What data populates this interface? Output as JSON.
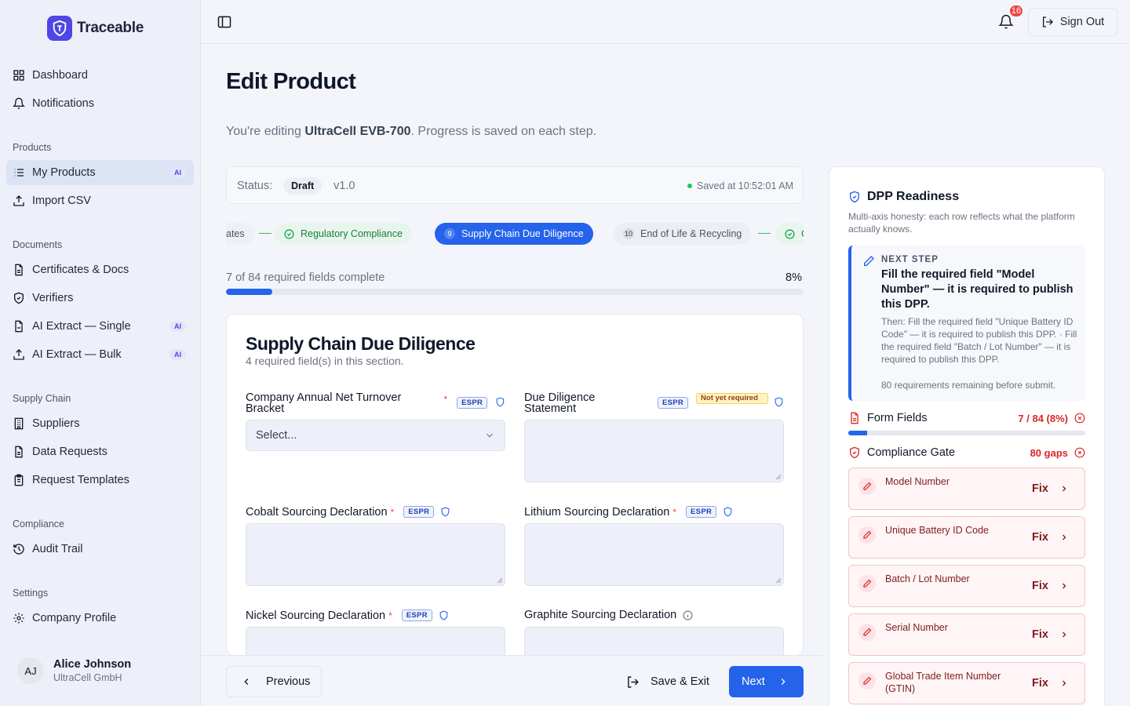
{
  "app": {
    "name": "Traceable"
  },
  "sidebar": {
    "top": [
      {
        "label": "Dashboard"
      },
      {
        "label": "Notifications"
      }
    ],
    "sections": {
      "products": "Products",
      "documents": "Documents",
      "supply_chain": "Supply Chain",
      "compliance": "Compliance",
      "settings": "Settings"
    },
    "items": {
      "my_products": "My Products",
      "import_csv": "Import CSV",
      "certificates": "Certificates & Docs",
      "verifiers": "Verifiers",
      "ai_single": "AI Extract — Single",
      "ai_bulk": "AI Extract — Bulk",
      "suppliers": "Suppliers",
      "data_requests": "Data Requests",
      "request_templates": "Request Templates",
      "audit_trail": "Audit Trail",
      "company_profile": "Company Profile"
    },
    "ai_badge": "AI",
    "user": {
      "initials": "AJ",
      "name": "Alice Johnson",
      "org": "UltraCell GmbH"
    }
  },
  "topbar": {
    "notification_count": "16",
    "sign_out": "Sign Out"
  },
  "page": {
    "title": "Edit Product",
    "subtitle_prefix": "You're editing ",
    "product_name": "UltraCell EVB-700",
    "subtitle_suffix": ". Progress is saved on each step."
  },
  "status": {
    "label": "Status:",
    "state": "Draft",
    "version": "v1.0",
    "saved": "Saved at 10:52:01 AM"
  },
  "stepper": {
    "steps": [
      {
        "label": "ates",
        "state": "done-partial"
      },
      {
        "label": "Regulatory Compliance",
        "state": "done"
      },
      {
        "num": "9",
        "label": "Supply Chain Due Diligence",
        "state": "current"
      },
      {
        "num": "10",
        "label": "End of Life & Recycling",
        "state": "todo"
      },
      {
        "label": "C",
        "state": "done"
      }
    ]
  },
  "progress": {
    "text": "7 of 84 required fields complete",
    "percent_label": "8%",
    "fraction": 0.08
  },
  "form": {
    "title": "Supply Chain Due Diligence",
    "subtitle": "4 required field(s) in this section.",
    "espr": "ESPR",
    "required_mark": "*",
    "not_yet_required": "Not yet required",
    "fields": {
      "turnover": {
        "label": "Company Annual Net Turnover Bracket",
        "placeholder": "Select..."
      },
      "dd_statement": {
        "label": "Due Diligence Statement"
      },
      "cobalt": {
        "label": "Cobalt Sourcing Declaration"
      },
      "lithium": {
        "label": "Lithium Sourcing Declaration"
      },
      "nickel": {
        "label": "Nickel Sourcing Declaration"
      },
      "graphite": {
        "label": "Graphite Sourcing Declaration"
      }
    }
  },
  "footer": {
    "previous": "Previous",
    "save_exit": "Save & Exit",
    "next": "Next"
  },
  "readiness": {
    "title": "DPP Readiness",
    "description": "Multi-axis honesty: each row reflects what the platform actually knows.",
    "next_step": {
      "label": "NEXT STEP",
      "main": "Fill the required field \"Model Number\" — it is required to publish this DPP.",
      "then": "Then: Fill the required field \"Unique Battery ID Code\" — it is required to publish this DPP. · Fill the required field \"Batch / Lot Number\" — it is required to publish this DPP.",
      "remaining": "80 requirements remaining before submit."
    },
    "form_fields": {
      "label": "Form Fields",
      "value": "7 / 84 (8%)",
      "fraction": 0.08
    },
    "compliance_gate": {
      "label": "Compliance Gate",
      "value": "80 gaps"
    },
    "fix_label": "Fix",
    "gaps": [
      {
        "label": "Model Number"
      },
      {
        "label": "Unique Battery ID Code"
      },
      {
        "label": "Batch / Lot Number"
      },
      {
        "label": "Serial Number"
      },
      {
        "label": "Global Trade Item Number (GTIN)"
      }
    ]
  }
}
